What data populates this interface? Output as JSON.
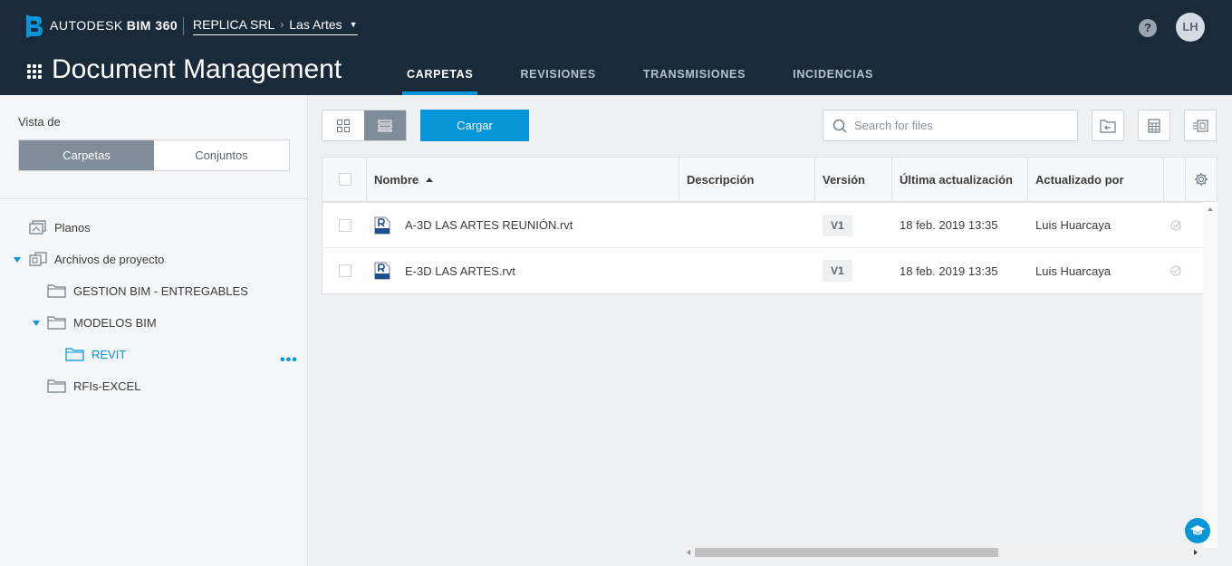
{
  "header": {
    "brand_left": "AUTODESK",
    "brand_right": "BIM 360",
    "account": "REPLICA SRL",
    "project": "Las Artes",
    "help": "?",
    "user_initials": "LH",
    "app_title": "Document Management",
    "tabs": [
      {
        "label": "CARPETAS",
        "active": true
      },
      {
        "label": "REVISIONES",
        "active": false
      },
      {
        "label": "TRANSMISIONES",
        "active": false
      },
      {
        "label": "INCIDENCIAS",
        "active": false
      }
    ]
  },
  "sidebar": {
    "view_label": "Vista de",
    "toggle": {
      "folders": "Carpetas",
      "sets": "Conjuntos"
    },
    "tree": [
      {
        "label": "Planos",
        "icon": "plans-icon"
      },
      {
        "label": "Archivos de proyecto",
        "icon": "project-files-icon",
        "expanded": true
      },
      {
        "label": "GESTION BIM - ENTREGABLES",
        "icon": "folder-icon"
      },
      {
        "label": "MODELOS BIM",
        "icon": "folder-icon",
        "expanded": true
      },
      {
        "label": "REVIT",
        "icon": "folder-icon",
        "selected": true
      },
      {
        "label": "RFIs-EXCEL",
        "icon": "folder-icon"
      }
    ]
  },
  "toolbar": {
    "upload_label": "Cargar",
    "search_placeholder": "Search for files"
  },
  "table": {
    "columns": [
      "Nombre",
      "Descripción",
      "Versión",
      "Última actualización",
      "Actualizado por"
    ],
    "rows": [
      {
        "name": "A-3D LAS ARTES REUNIÓN.rvt",
        "description": "",
        "version": "V1",
        "updated": "18 feb. 2019 13:35",
        "updated_by": "Luis Huarcaya"
      },
      {
        "name": "E-3D LAS ARTES.rvt",
        "description": "",
        "version": "V1",
        "updated": "18 feb. 2019 13:35",
        "updated_by": "Luis Huarcaya"
      }
    ]
  },
  "colors": {
    "header_bg": "#1b2a3b",
    "accent": "#0696d7",
    "toggle_active": "#808c98"
  }
}
